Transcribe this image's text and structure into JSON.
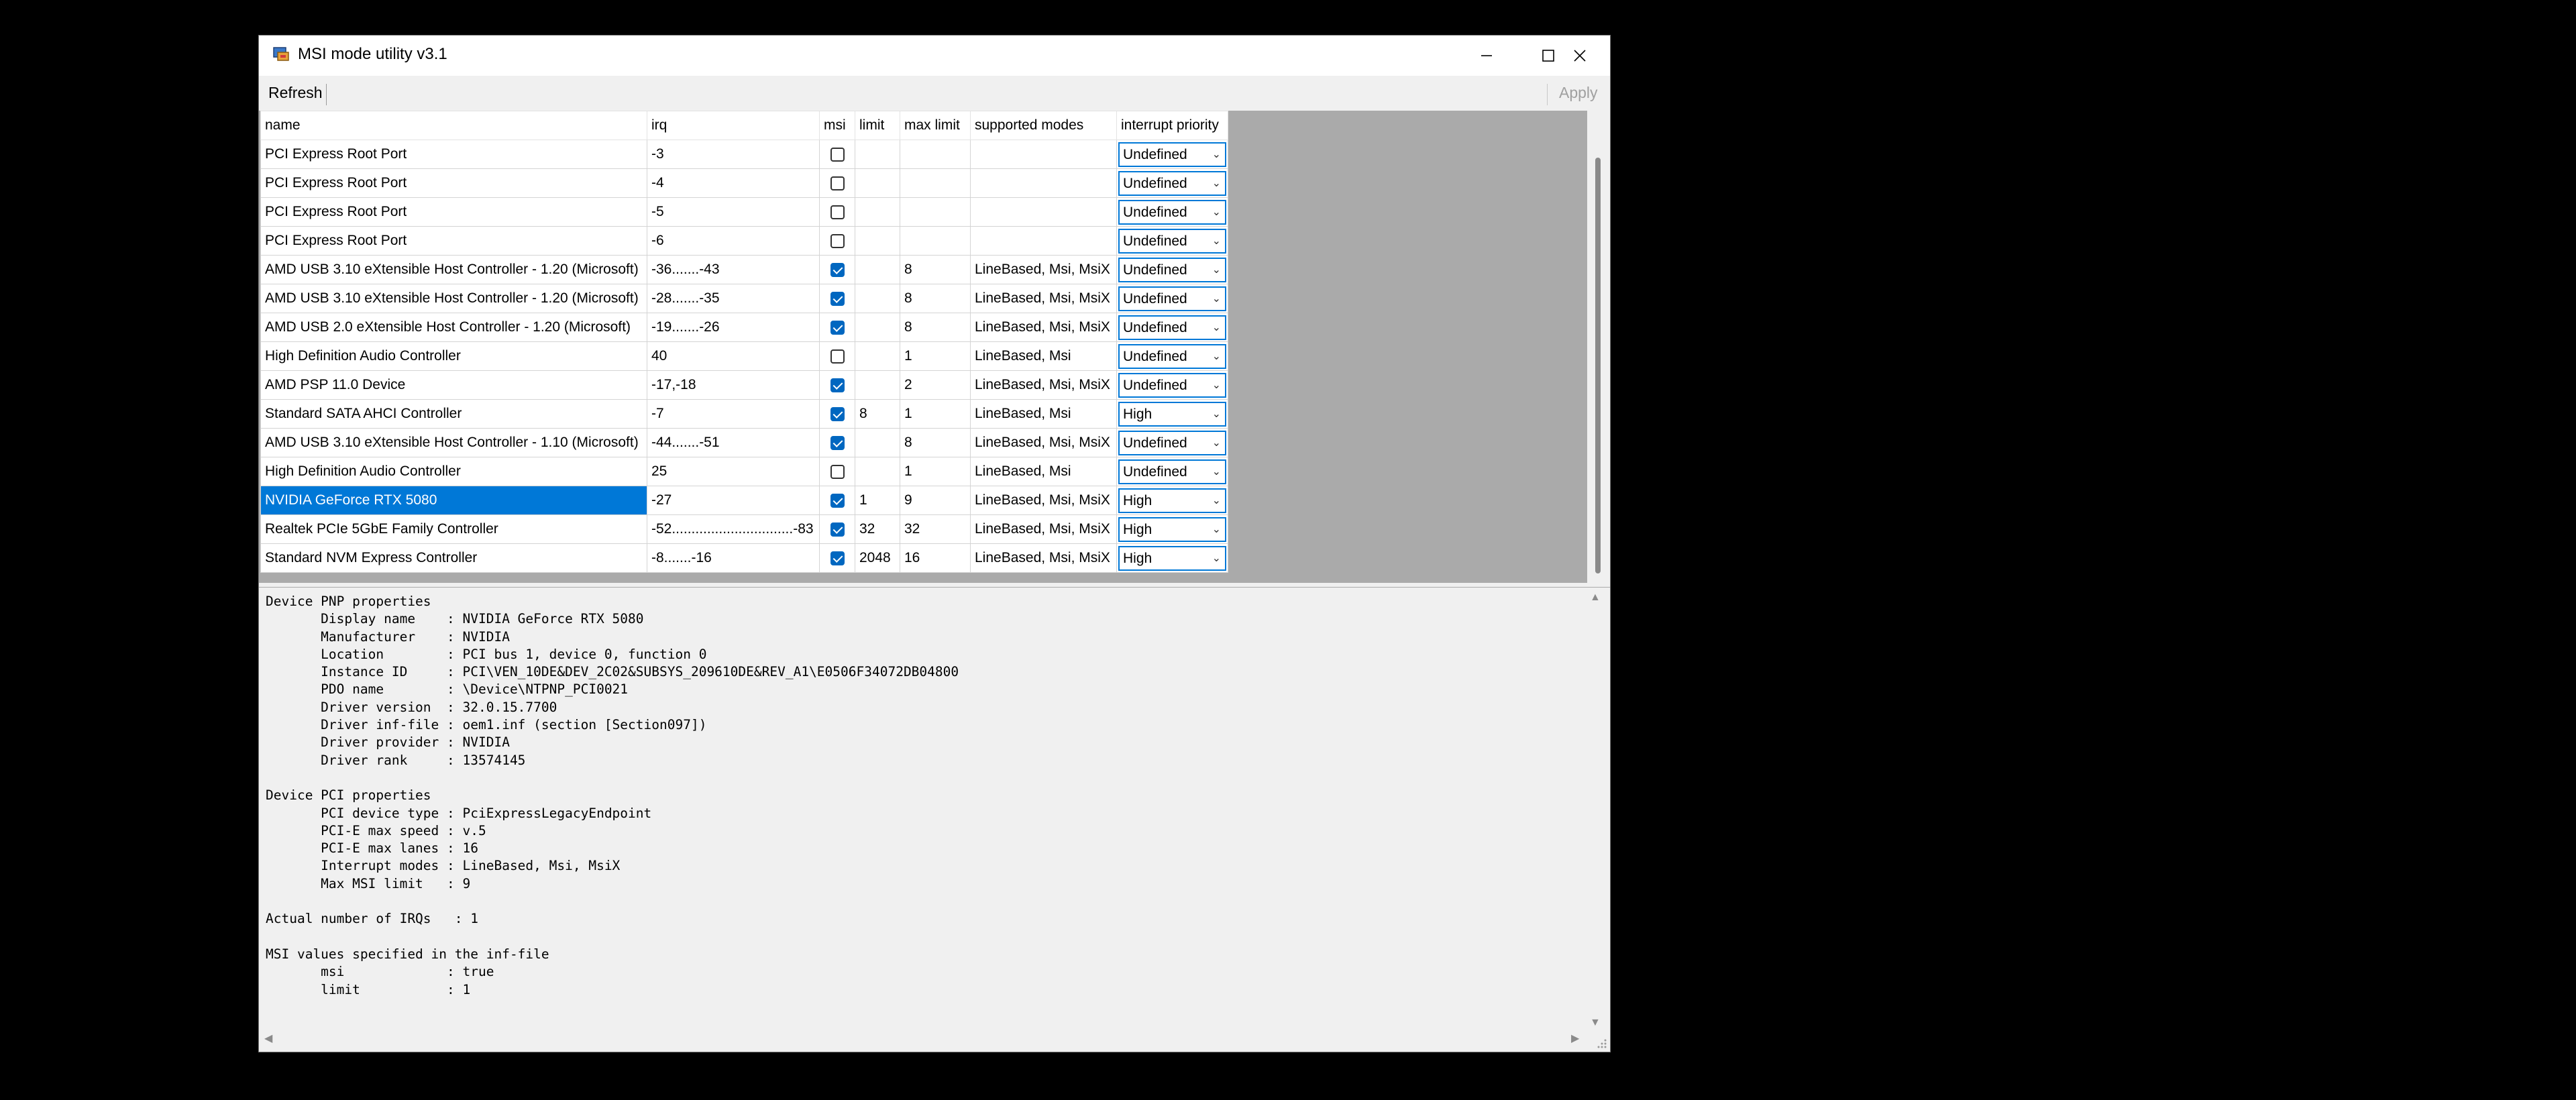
{
  "window": {
    "title": "MSI mode utility v3.1"
  },
  "toolbar": {
    "refresh_label": "Refresh",
    "apply_label": "Apply"
  },
  "grid": {
    "columns": [
      "name",
      "irq",
      "msi",
      "limit",
      "max limit",
      "supported modes",
      "interrupt priority"
    ],
    "selected_index": 12,
    "rows": [
      {
        "name": "PCI Express Root Port",
        "irq": "-3",
        "msi": false,
        "limit": "",
        "max_limit": "",
        "modes": "",
        "priority": "Undefined"
      },
      {
        "name": "PCI Express Root Port",
        "irq": "-4",
        "msi": false,
        "limit": "",
        "max_limit": "",
        "modes": "",
        "priority": "Undefined"
      },
      {
        "name": "PCI Express Root Port",
        "irq": "-5",
        "msi": false,
        "limit": "",
        "max_limit": "",
        "modes": "",
        "priority": "Undefined"
      },
      {
        "name": "PCI Express Root Port",
        "irq": "-6",
        "msi": false,
        "limit": "",
        "max_limit": "",
        "modes": "",
        "priority": "Undefined"
      },
      {
        "name": "AMD USB 3.10 eXtensible Host Controller - 1.20 (Microsoft)",
        "irq": "-36.......-43",
        "msi": true,
        "limit": "",
        "max_limit": "8",
        "modes": "LineBased, Msi, MsiX",
        "priority": "Undefined"
      },
      {
        "name": "AMD USB 3.10 eXtensible Host Controller - 1.20 (Microsoft)",
        "irq": "-28.......-35",
        "msi": true,
        "limit": "",
        "max_limit": "8",
        "modes": "LineBased, Msi, MsiX",
        "priority": "Undefined"
      },
      {
        "name": "AMD USB 2.0 eXtensible Host Controller - 1.20 (Microsoft)",
        "irq": "-19.......-26",
        "msi": true,
        "limit": "",
        "max_limit": "8",
        "modes": "LineBased, Msi, MsiX",
        "priority": "Undefined"
      },
      {
        "name": "High Definition Audio Controller",
        "irq": "40",
        "msi": false,
        "limit": "",
        "max_limit": "1",
        "modes": "LineBased, Msi",
        "priority": "Undefined"
      },
      {
        "name": "AMD PSP 11.0 Device",
        "irq": "-17,-18",
        "msi": true,
        "limit": "",
        "max_limit": "2",
        "modes": "LineBased, Msi, MsiX",
        "priority": "Undefined"
      },
      {
        "name": "Standard SATA AHCI Controller",
        "irq": "-7",
        "msi": true,
        "limit": "8",
        "max_limit": "1",
        "modes": "LineBased, Msi",
        "priority": "High"
      },
      {
        "name": "AMD USB 3.10 eXtensible Host Controller - 1.10 (Microsoft)",
        "irq": "-44.......-51",
        "msi": true,
        "limit": "",
        "max_limit": "8",
        "modes": "LineBased, Msi, MsiX",
        "priority": "Undefined"
      },
      {
        "name": "High Definition Audio Controller",
        "irq": "25",
        "msi": false,
        "limit": "",
        "max_limit": "1",
        "modes": "LineBased, Msi",
        "priority": "Undefined"
      },
      {
        "name": "NVIDIA GeForce RTX 5080",
        "irq": "-27",
        "msi": true,
        "limit": "1",
        "max_limit": "9",
        "modes": "LineBased, Msi, MsiX",
        "priority": "High"
      },
      {
        "name": "Realtek PCIe 5GbE Family Controller",
        "irq": "-52...............................-83",
        "msi": true,
        "limit": "32",
        "max_limit": "32",
        "modes": "LineBased, Msi, MsiX",
        "priority": "High"
      },
      {
        "name": "Standard NVM Express Controller",
        "irq": "-8.......-16",
        "msi": true,
        "limit": "2048",
        "max_limit": "16",
        "modes": "LineBased, Msi, MsiX",
        "priority": "High"
      }
    ]
  },
  "details": {
    "lines": [
      "Device PNP properties",
      "       Display name    : NVIDIA GeForce RTX 5080",
      "       Manufacturer    : NVIDIA",
      "       Location        : PCI bus 1, device 0, function 0",
      "       Instance ID     : PCI\\VEN_10DE&DEV_2C02&SUBSYS_209610DE&REV_A1\\E0506F34072DB04800",
      "       PDO name        : \\Device\\NTPNP_PCI0021",
      "       Driver version  : 32.0.15.7700",
      "       Driver inf-file : oem1.inf (section [Section097])",
      "       Driver provider : NVIDIA",
      "       Driver rank     : 13574145",
      "",
      "Device PCI properties",
      "       PCI device type : PciExpressLegacyEndpoint",
      "       PCI-E max speed : v.5",
      "       PCI-E max lanes : 16",
      "       Interrupt modes : LineBased, Msi, MsiX",
      "       Max MSI limit   : 9",
      "",
      "Actual number of IRQs   : 1",
      "",
      "MSI values specified in the inf-file",
      "       msi             : true",
      "       limit           : 1"
    ]
  }
}
